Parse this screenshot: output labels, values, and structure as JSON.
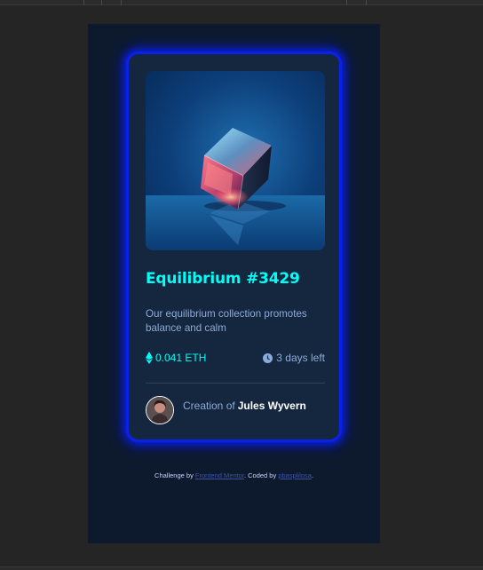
{
  "card": {
    "image_alt": "Equilibrium crystal cube",
    "title": "Equilibrium #3429",
    "description": "Our equilibrium collection promotes balance and calm",
    "price": "0.041 ETH",
    "time_left": "3 days left",
    "creator_prefix": "Creation of",
    "creator_name": "Jules Wyvern"
  },
  "attribution": {
    "prefix": "Challenge by ",
    "challenge_link": "Frontend Mentor",
    "middle": ". Coded by ",
    "author_link": "pbasplilosa",
    "suffix": "."
  },
  "icons": {
    "price": "ethereum-icon",
    "time": "clock-icon"
  },
  "colors": {
    "background": "#252525",
    "page": "#0d1a2e",
    "card": "#15263f",
    "accent_cyan": "#00fff7",
    "soft_blue": "#8bacda",
    "glow_border": "#0a22e8"
  }
}
